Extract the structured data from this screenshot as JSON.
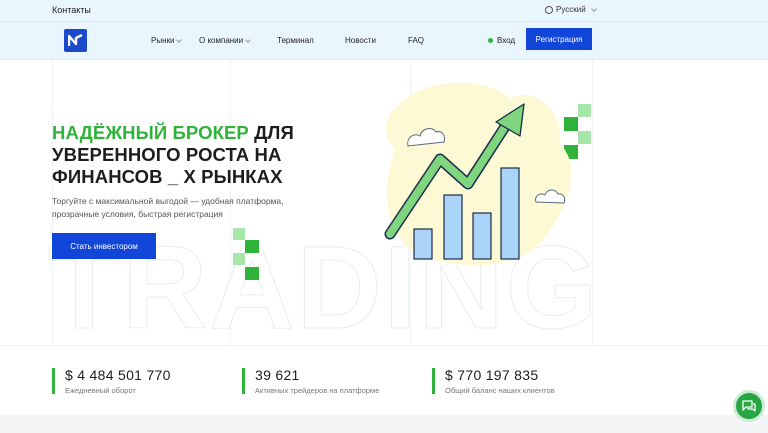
{
  "topbar": {
    "contacts": "Контакты",
    "language": "Русский",
    "globe_icon": "globe-icon"
  },
  "nav": {
    "items": [
      {
        "label": "Рынки",
        "dropdown": true
      },
      {
        "label": "О компании",
        "dropdown": true
      },
      {
        "label": "Терминал",
        "dropdown": false
      },
      {
        "label": "Новости",
        "dropdown": false
      },
      {
        "label": "FAQ",
        "dropdown": false
      }
    ],
    "login": "Вход",
    "register": "Регистрация"
  },
  "hero": {
    "title_accent": "НАДЁЖНЫЙ БРОКЕР",
    "title_rest": " ДЛЯ УВЕРЕННОГО РОСТА НА ФИНАНСОВ _ Х РЫНКАХ",
    "subtitle": "Торгуйте с максимальной выгодой — удобная платформа, прозрачные условия, быстрая регистрация",
    "cta": "Стать инвестором",
    "watermark": "TRADING"
  },
  "stats": [
    {
      "value": "$ 4 484 501 770",
      "label": "Ежедневный оборот"
    },
    {
      "value": "39 621",
      "label": "Активных трейдеров на платформе"
    },
    {
      "value": "$ 770 197 835",
      "label": "Общий баланс наших клиентов"
    }
  ],
  "colors": {
    "accent_green": "#2fb33b",
    "brand_blue": "#1146d8",
    "header_bg": "#eaf6fd"
  },
  "chat": {
    "icon": "chat-icon"
  }
}
